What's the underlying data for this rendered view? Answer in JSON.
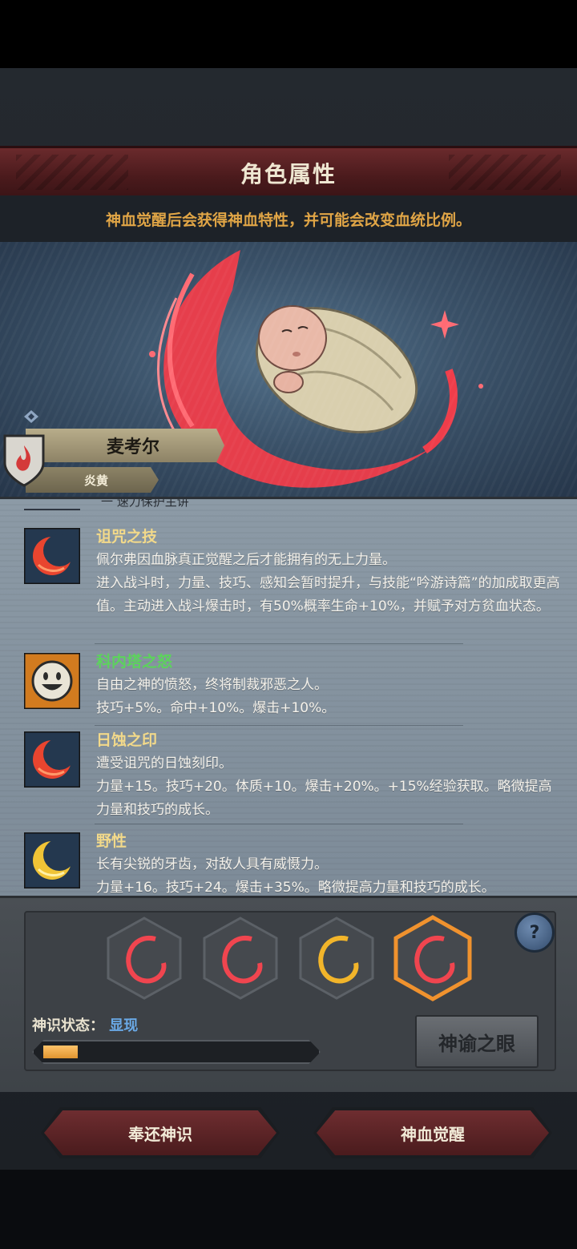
{
  "header": {
    "title": "角色属性"
  },
  "hint": "神血觉醒后会获得神血特性，并可能会改变血统比例。",
  "character": {
    "name": "麦考尔",
    "origin": "炎黄"
  },
  "cut_off_text": "一 速力保护主讲",
  "skills": [
    {
      "title": "诅咒之技",
      "title_color": "#f2d98a",
      "icon": "red-crescent-icon",
      "desc": "佩尔弗因血脉真正觉醒之后才能拥有的无上力量。\n进入战斗时，力量、技巧、感知会暂时提升，与技能“吟游诗篇”的加成取更高值。主动进入战斗爆击时，有50%概率生命+10%，并赋予对方贫血状态。"
    },
    {
      "title": "科内塔之怒",
      "title_color": "#5cd35c",
      "icon": "smiley-face-icon",
      "desc": "自由之神的愤怒，终将制裁邪恶之人。\n技巧+5%。命中+10%。爆击+10%。"
    },
    {
      "title": "日蚀之印",
      "title_color": "#f2d98a",
      "icon": "red-crescent-icon",
      "desc": "遭受诅咒的日蚀刻印。\n力量+15。技巧+20。体质+10。爆击+20%。+15%经验获取。略微提高力量和技巧的成长。"
    },
    {
      "title": "野性",
      "title_color": "#f2d98a",
      "icon": "yellow-crescent-icon",
      "desc": "长有尖锐的牙齿，对敌人具有威慑力。\n力量+16。技巧+24。爆击+35%。略微提高力量和技巧的成长。"
    }
  ],
  "slots": [
    {
      "color": "red",
      "selected": false
    },
    {
      "color": "red",
      "selected": false
    },
    {
      "color": "yellow",
      "selected": false
    },
    {
      "color": "red",
      "selected": true
    }
  ],
  "help": "?",
  "status": {
    "label": "神识状态：",
    "value": "显现",
    "progress": 0.13
  },
  "buttons": {
    "oracle": "神谕之眼",
    "return": "奉还神识",
    "awaken": "神血觉醒"
  },
  "colors": {
    "accent_red": "#f0454f",
    "gold": "#e0a546",
    "status_blue": "#6aa9e6"
  }
}
